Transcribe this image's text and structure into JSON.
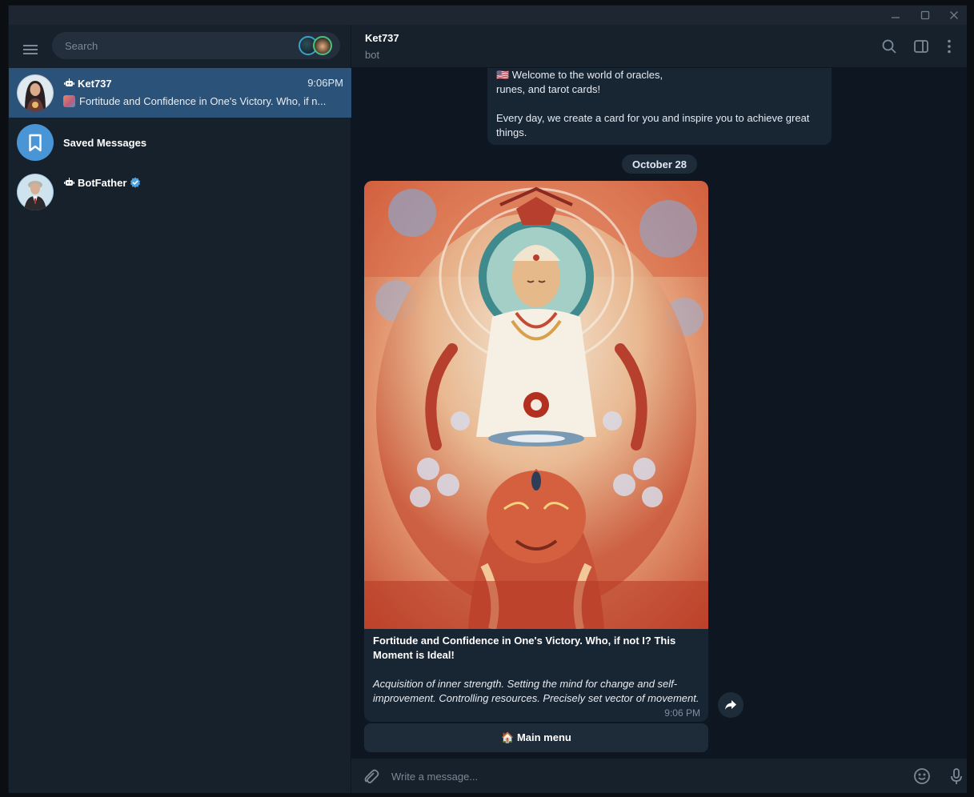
{
  "window": {
    "controls": [
      "minimize-icon",
      "maximize-icon",
      "close-icon"
    ]
  },
  "sidebar": {
    "search_placeholder": "Search",
    "chats": [
      {
        "name": "Ket737",
        "is_bot": true,
        "time": "9:06PM",
        "preview": "Fortitude and Confidence in One's Victory. Who, if n...",
        "active": true
      },
      {
        "name": "Saved Messages",
        "is_bot": false,
        "time": "",
        "preview": "",
        "active": false
      },
      {
        "name": "BotFather",
        "is_bot": true,
        "verified": true,
        "time": "",
        "preview": "",
        "active": false
      }
    ]
  },
  "header": {
    "title": "Ket737",
    "subtitle": "bot"
  },
  "messages": {
    "prev_line1": "🇺🇸 Welcome to the world of oracles,",
    "prev_line2": "runes, and tarot cards!",
    "prev_line3": "Every day, we create a card for you and inspire you to achieve great",
    "prev_line4": "things.",
    "date": "October 28",
    "photo_caption_title": "Fortitude and Confidence in One's Victory. Who, if not I? This Moment is Ideal!",
    "photo_caption_body": "Acquisition of inner strength. Setting the mind for change and self-improvement. Controlling resources. Precisely set vector of movement.",
    "photo_time": "9:06 PM",
    "keyboard_button": "🏠 Main menu"
  },
  "composer": {
    "placeholder": "Write a message..."
  },
  "colors": {
    "sidebar_bg": "#17212b",
    "chat_bg": "#0e1621",
    "active_chat": "#2b5278",
    "bubble": "#182533",
    "accent": "#5288c1"
  }
}
